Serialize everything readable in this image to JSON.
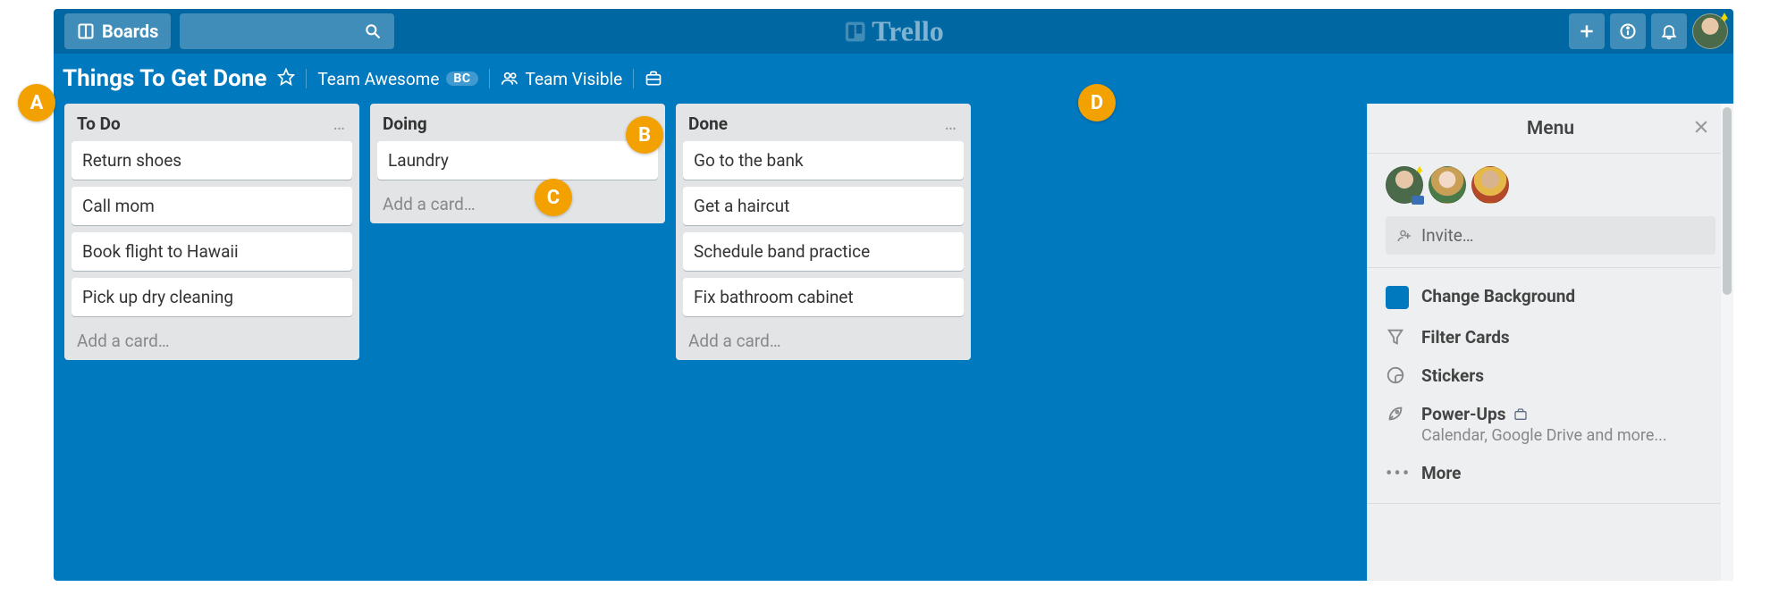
{
  "topbar": {
    "boards_label": "Boards",
    "logo_text": "Trello"
  },
  "board_header": {
    "title": "Things To Get Done",
    "team_label": "Team Awesome",
    "team_badge": "BC",
    "visibility_label": "Team Visible"
  },
  "lists": [
    {
      "title": "To Do",
      "cards": [
        "Return shoes",
        "Call mom",
        "Book flight to Hawaii",
        "Pick up dry cleaning"
      ],
      "add_label": "Add a card…"
    },
    {
      "title": "Doing",
      "cards": [
        "Laundry"
      ],
      "add_label": "Add a card…"
    },
    {
      "title": "Done",
      "cards": [
        "Go to the bank",
        "Get a haircut",
        "Schedule band practice",
        "Fix bathroom cabinet"
      ],
      "add_label": "Add a card…"
    }
  ],
  "menu": {
    "title": "Menu",
    "invite_label": "Invite…",
    "items": {
      "change_bg": "Change Background",
      "filter": "Filter Cards",
      "stickers": "Stickers",
      "powerups": "Power-Ups",
      "powerups_sub": "Calendar, Google Drive and more...",
      "more": "More"
    }
  },
  "annotations": {
    "a": "A",
    "b": "B",
    "c": "C",
    "d": "D"
  }
}
